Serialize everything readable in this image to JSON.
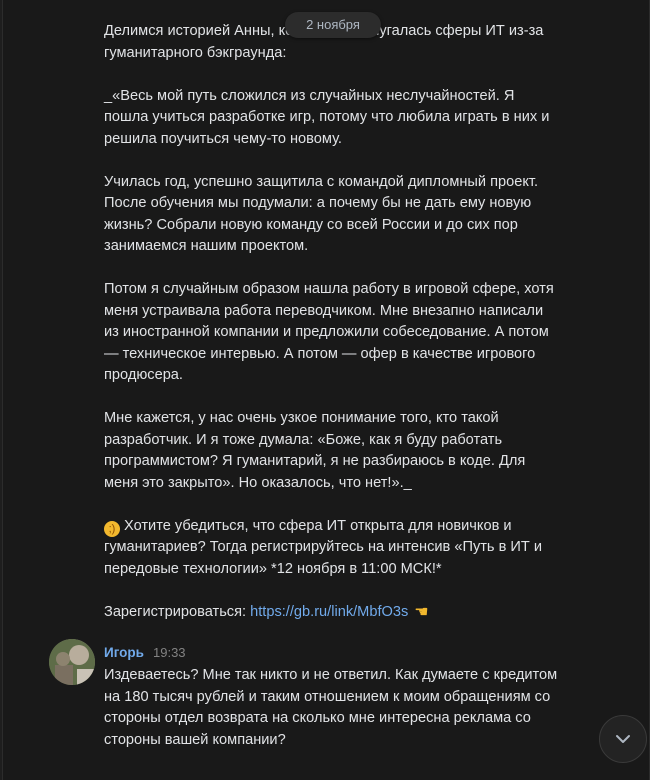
{
  "date_pill": "2 ноября",
  "post": {
    "paragraphs": [
      "Делимся историей Анны, которая не испугалась сферы ИТ из-за гуманитарного бэкграунда:",
      "_«Весь мой путь сложился из случайных неслучайностей. Я пошла учиться разработке игр, потому что любила играть в них и решила поучиться чему-то новому.",
      "Училась год, успешно защитила с командой дипломный проект. После обучения мы подумали: а почему бы не дать ему новую жизнь? Собрали новую команду со всей России и до сих пор занимаемся нашим проектом.",
      "Потом я случайным образом нашла работу в игровой сфере, хотя меня устраивала работа переводчиком. Мне внезапно написали из иностранной компании и предложили собеседование. А потом — техническое интервью. А потом — офер в качестве игрового продюсера.",
      "Мне кажется, у нас очень узкое понимание того, кто такой разработчик. И я тоже думала: «Боже, как я буду работать программистом? Я гуманитарий, я не разбираюсь в коде. Для меня это закрыто». Но оказалось, что нет!»._",
      "Хотите убедиться, что сфера ИТ открыта для новичков и гуманитариев? Тогда регистрируйтесь на интенсив «Путь в ИТ и передовые технологии» *12 ноября в 11:00 МСК!*"
    ],
    "register_label": "Зарегистрироваться:",
    "register_link": "https://gb.ru/link/MbfO3s",
    "emoji_wink": "😉",
    "emoji_point": "👈"
  },
  "reply": {
    "author": "Игорь",
    "time": "19:33",
    "text": "Издеваетесь? Мне так никто и не ответил. Как думаете с кредитом на 180 тысяч рублей и таким отношением к моим обращениям со стороны отдел возврата на сколько мне интересна реклама со стороны вашей компании?"
  },
  "icons": {
    "scroll_down": "chevron-down-icon"
  }
}
